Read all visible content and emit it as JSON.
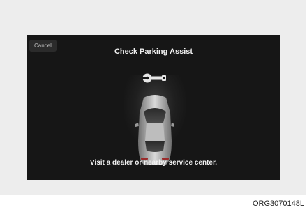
{
  "dialog": {
    "cancel_label": "Cancel",
    "title": "Check Parking Assist",
    "message": "Visit a dealer or nearby service center."
  },
  "icons": {
    "warning": "wrench-icon",
    "vehicle": "car-icon"
  },
  "figure_code": "ORG3070148L",
  "colors": {
    "screen_bg": "#161616",
    "frame_bg": "#ededed",
    "text": "#f0f0f0"
  }
}
